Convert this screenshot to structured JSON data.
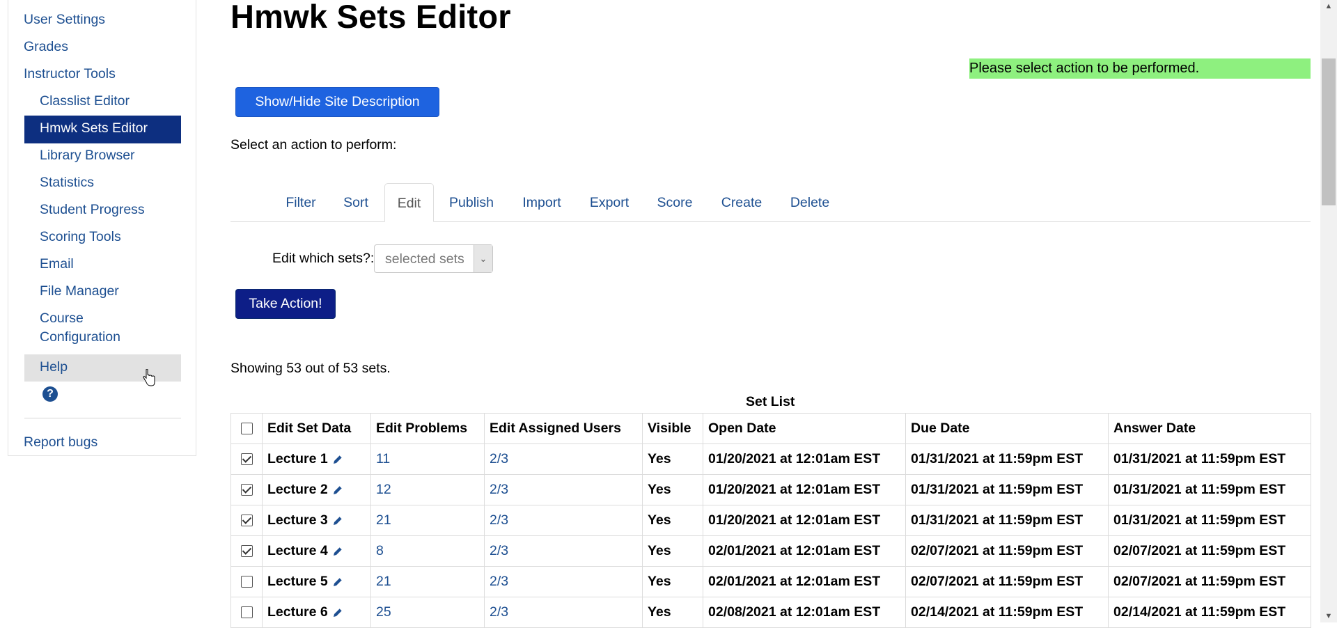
{
  "sidebar": {
    "items": [
      {
        "label": "User Settings",
        "level": 0
      },
      {
        "label": "Grades",
        "level": 0
      },
      {
        "label": "Instructor Tools",
        "level": 0
      },
      {
        "label": "Classlist Editor",
        "level": 1
      },
      {
        "label": "Hmwk Sets Editor",
        "level": 1,
        "active": true
      },
      {
        "label": "Library Browser",
        "level": 1
      },
      {
        "label": "Statistics",
        "level": 1
      },
      {
        "label": "Student Progress",
        "level": 1
      },
      {
        "label": "Scoring Tools",
        "level": 1
      },
      {
        "label": "Email",
        "level": 1
      },
      {
        "label": "File Manager",
        "level": 1
      },
      {
        "label": "Course",
        "label2": "Configuration",
        "level": 1
      },
      {
        "label": "Help",
        "level": 1,
        "hovered": true
      }
    ],
    "help_icon": "question-circle-icon",
    "report_bugs": "Report bugs"
  },
  "main": {
    "title": "Hmwk Sets Editor",
    "message": "Please select action to be performed.",
    "site_description_button": "Show/Hide Site Description",
    "select_action_label": "Select an action to perform:",
    "tabs": [
      {
        "label": "Filter"
      },
      {
        "label": "Sort"
      },
      {
        "label": "Edit",
        "active": true
      },
      {
        "label": "Publish"
      },
      {
        "label": "Import"
      },
      {
        "label": "Export"
      },
      {
        "label": "Score"
      },
      {
        "label": "Create"
      },
      {
        "label": "Delete"
      }
    ],
    "edit_which_label": "Edit which sets?:",
    "edit_which_value": "selected sets",
    "take_action_button": "Take Action!",
    "showing_text": "Showing 53 out of 53 sets.",
    "table_caption": "Set List",
    "columns": [
      "",
      "Edit Set Data",
      "Edit Problems",
      "Edit Assigned Users",
      "Visible",
      "Open Date",
      "Due Date",
      "Answer Date"
    ],
    "rows": [
      {
        "checked": true,
        "set": "Lecture 1",
        "problems": "11",
        "users": "2/3",
        "visible": "Yes",
        "open": "01/20/2021 at 12:01am EST",
        "due": "01/31/2021 at 11:59pm EST",
        "answer": "01/31/2021 at 11:59pm EST"
      },
      {
        "checked": true,
        "set": "Lecture 2",
        "problems": "12",
        "users": "2/3",
        "visible": "Yes",
        "open": "01/20/2021 at 12:01am EST",
        "due": "01/31/2021 at 11:59pm EST",
        "answer": "01/31/2021 at 11:59pm EST"
      },
      {
        "checked": true,
        "set": "Lecture 3",
        "problems": "21",
        "users": "2/3",
        "visible": "Yes",
        "open": "01/20/2021 at 12:01am EST",
        "due": "01/31/2021 at 11:59pm EST",
        "answer": "01/31/2021 at 11:59pm EST"
      },
      {
        "checked": true,
        "set": "Lecture 4",
        "problems": "8",
        "users": "2/3",
        "visible": "Yes",
        "open": "02/01/2021 at 12:01am EST",
        "due": "02/07/2021 at 11:59pm EST",
        "answer": "02/07/2021 at 11:59pm EST"
      },
      {
        "checked": false,
        "set": "Lecture 5",
        "problems": "21",
        "users": "2/3",
        "visible": "Yes",
        "open": "02/01/2021 at 12:01am EST",
        "due": "02/07/2021 at 11:59pm EST",
        "answer": "02/07/2021 at 11:59pm EST"
      },
      {
        "checked": false,
        "set": "Lecture 6",
        "problems": "25",
        "users": "2/3",
        "visible": "Yes",
        "open": "02/08/2021 at 12:01am EST",
        "due": "02/14/2021 at 11:59pm EST",
        "answer": "02/14/2021 at 11:59pm EST"
      }
    ]
  },
  "colors": {
    "link": "#1d4f91",
    "active_nav_bg": "#0d2f80",
    "message_bg": "#8ef07f",
    "primary_button": "#1e63e0",
    "action_button": "#0d1e87"
  }
}
